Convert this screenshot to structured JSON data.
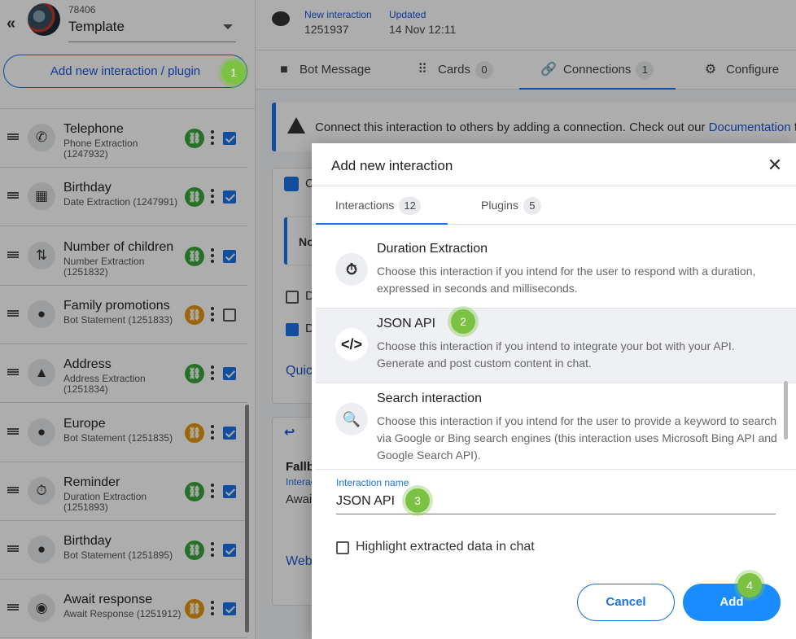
{
  "sidebar": {
    "bot_id": "78406",
    "bot_name": "Template",
    "add_button_label": "Add new interaction / plugin",
    "items": [
      {
        "title": "Telephone",
        "subtitle": "Phone Extraction (1247932)",
        "icon": "phone-icon",
        "link_status": "green",
        "checked": true
      },
      {
        "title": "Birthday",
        "subtitle": "Date Extraction (1247991)",
        "icon": "calendar-icon",
        "link_status": "green",
        "checked": true
      },
      {
        "title": "Number of children",
        "subtitle": "Number Extraction (1251832)",
        "icon": "sort-numbers-icon",
        "link_status": "green",
        "checked": true
      },
      {
        "title": "Family promotions",
        "subtitle": "Bot Statement (1251833)",
        "icon": "chat-bubble-icon",
        "link_status": "orange",
        "checked": false
      },
      {
        "title": "Address",
        "subtitle": "Address Extraction (1251834)",
        "icon": "map-icon",
        "link_status": "green",
        "checked": true
      },
      {
        "title": "Europe",
        "subtitle": "Bot Statement (1251835)",
        "icon": "chat-bubble-icon",
        "link_status": "orange",
        "checked": true
      },
      {
        "title": "Reminder",
        "subtitle": "Duration Extraction (1251893)",
        "icon": "timer-icon",
        "link_status": "green",
        "checked": true
      },
      {
        "title": "Birthday",
        "subtitle": "Bot Statement (1251895)",
        "icon": "chat-bubble-icon",
        "link_status": "green",
        "checked": true
      },
      {
        "title": "Await response",
        "subtitle": "Await Response (1251912)",
        "icon": "user-circle-icon",
        "link_status": "orange",
        "checked": true
      }
    ]
  },
  "header": {
    "new_label": "New interaction",
    "new_value": "1251937",
    "updated_label": "Updated",
    "updated_value": "14 Nov 12:11"
  },
  "tabs": [
    {
      "label": "Bot Message",
      "icon": "chat-bubble-icon"
    },
    {
      "label": "Cards",
      "count": "0",
      "icon": "grid-icon"
    },
    {
      "label": "Connections",
      "count": "1",
      "icon": "link-icon"
    },
    {
      "label": "Configure",
      "icon": "gear-icon"
    }
  ],
  "alert": {
    "text": "Connect this interaction to others by adding a connection. Check out our ",
    "link": "Documentation",
    "tail": " f"
  },
  "background_fragments": {
    "card1_head": "C",
    "no": "No",
    "d1": "D",
    "d2": "D",
    "quick": "Quic",
    "fallback": "Fallb",
    "interac": "Interac",
    "await": "Awai",
    "webh": "Webh"
  },
  "modal": {
    "title": "Add new interaction",
    "tabs": [
      {
        "label": "Interactions",
        "count": "12"
      },
      {
        "label": "Plugins",
        "count": "5"
      }
    ],
    "options": [
      {
        "title": "Duration Extraction",
        "desc": "Choose this interaction if you intend for the user to respond with a duration, expressed in seconds and milliseconds.",
        "icon": "timer-icon"
      },
      {
        "title": "JSON API",
        "desc": "Choose this interaction if you intend to integrate your bot with your API. Generate and post custom content in chat.",
        "icon": "code-icon"
      },
      {
        "title": "Search interaction",
        "desc": "Choose this interaction if you intend for the user to provide a keyword to search via Google or Bing search engines (this interaction uses Microsoft Bing API and Google Search API).",
        "icon": "search-icon"
      }
    ],
    "name_label": "Interaction name",
    "name_value": "JSON API",
    "highlight_label": "Highlight extracted data in chat",
    "cancel_label": "Cancel",
    "add_label": "Add"
  },
  "steps": [
    "1",
    "2",
    "3",
    "4"
  ]
}
